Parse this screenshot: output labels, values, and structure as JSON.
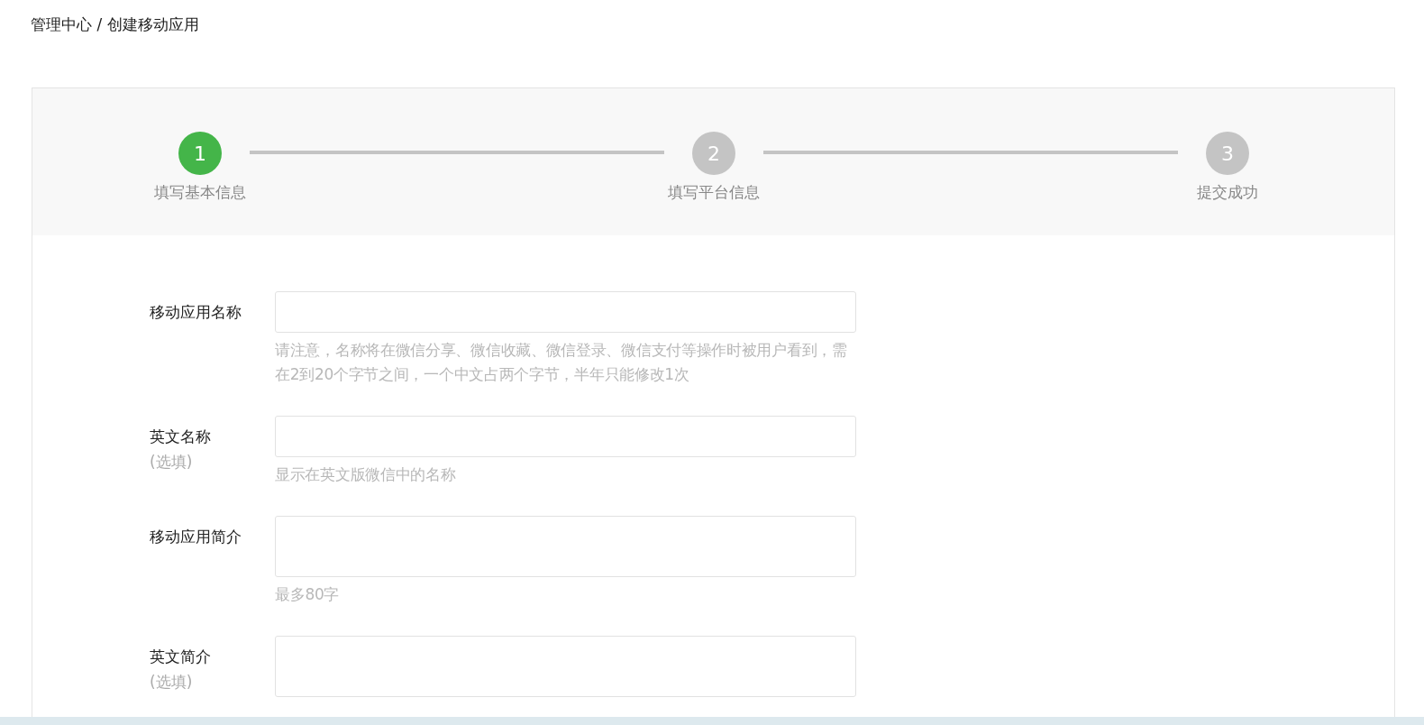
{
  "breadcrumb": "管理中心 / 创建移动应用",
  "steps": [
    {
      "number": "1",
      "label": "填写基本信息",
      "selected": true
    },
    {
      "number": "2",
      "label": "填写平台信息",
      "selected": false
    },
    {
      "number": "3",
      "label": "提交成功",
      "selected": false
    }
  ],
  "fields": [
    {
      "kind": "input",
      "label": "移动应用名称",
      "hint": "请注意，名称将在微信分享、微信收藏、微信登录、微信支付等操作时被用户看到，需在2到20个字节之间，一个中文占两个字节，半年只能修改1次"
    },
    {
      "kind": "input",
      "label": "英文名称",
      "note": "(选填)",
      "hint": "显示在英文版微信中的名称"
    },
    {
      "kind": "textarea",
      "label": "移动应用简介",
      "hint": "最多80字"
    },
    {
      "kind": "textarea",
      "label": "英文简介",
      "note": "(选填)"
    }
  ]
}
